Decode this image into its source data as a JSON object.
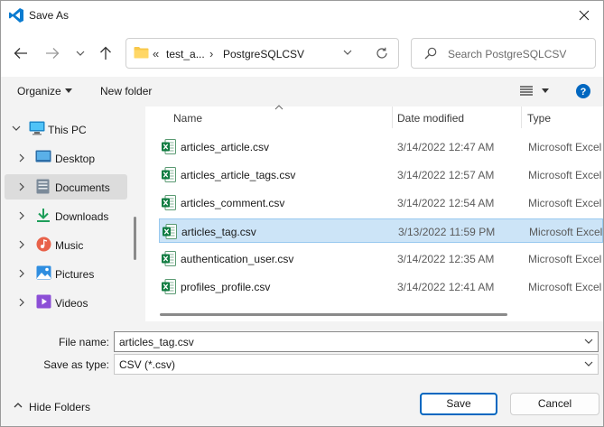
{
  "window": {
    "title": "Save As"
  },
  "address": {
    "segment1": "test_a...",
    "segment2": "PostgreSQLCSV",
    "chevrons": "«",
    "separator": "›"
  },
  "search": {
    "placeholder": "Search PostgreSQLCSV"
  },
  "commands": {
    "organize": "Organize",
    "new_folder": "New folder"
  },
  "sidebar": {
    "items": [
      {
        "label": "This PC",
        "icon": "monitor-icon"
      },
      {
        "label": "Desktop",
        "icon": "desktop-icon"
      },
      {
        "label": "Documents",
        "icon": "documents-icon",
        "selected": true
      },
      {
        "label": "Downloads",
        "icon": "download-icon"
      },
      {
        "label": "Music",
        "icon": "music-icon"
      },
      {
        "label": "Pictures",
        "icon": "pictures-icon"
      },
      {
        "label": "Videos",
        "icon": "videos-icon"
      }
    ]
  },
  "columns": {
    "name": "Name",
    "date": "Date modified",
    "type": "Type"
  },
  "files": [
    {
      "name": "articles_article.csv",
      "date": "3/14/2022 12:47 AM",
      "type": "Microsoft Excel"
    },
    {
      "name": "articles_article_tags.csv",
      "date": "3/14/2022 12:57 AM",
      "type": "Microsoft Excel"
    },
    {
      "name": "articles_comment.csv",
      "date": "3/14/2022 12:54 AM",
      "type": "Microsoft Excel"
    },
    {
      "name": "articles_tag.csv",
      "date": "3/13/2022 11:59 PM",
      "type": "Microsoft Excel",
      "selected": true
    },
    {
      "name": "authentication_user.csv",
      "date": "3/14/2022 12:35 AM",
      "type": "Microsoft Excel"
    },
    {
      "name": "profiles_profile.csv",
      "date": "3/14/2022 12:41 AM",
      "type": "Microsoft Excel"
    }
  ],
  "form": {
    "filename_label": "File name:",
    "filename_value": "articles_tag.csv",
    "savetype_label": "Save as type:",
    "savetype_value": "CSV (*.csv)"
  },
  "footer": {
    "hide_folders": "Hide Folders",
    "save": "Save",
    "cancel": "Cancel"
  },
  "colors": {
    "accent": "#0067c0",
    "selection": "#cce4f7",
    "excel_green": "#107c41",
    "folder_yellow": "#f8c84a"
  }
}
